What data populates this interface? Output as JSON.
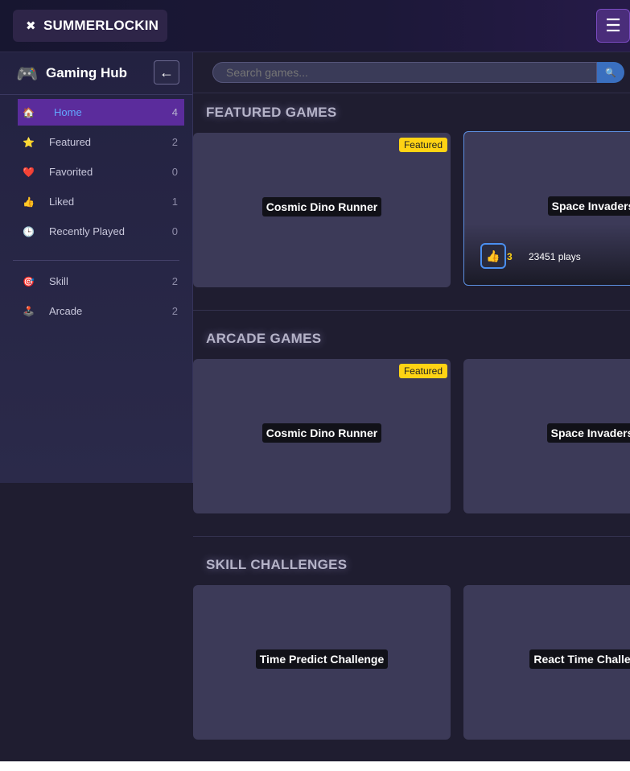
{
  "brand": {
    "icon": "✖",
    "name": "SUMMERLOCKIN"
  },
  "menu_icon": "☰",
  "sidebar": {
    "logo_icon": "🎮",
    "title": "Gaming Hub",
    "collapse_icon": "←",
    "items": [
      {
        "icon": "🏠",
        "label": "Home",
        "count": "4",
        "active": true
      },
      {
        "icon": "⭐",
        "label": "Featured",
        "count": "2"
      },
      {
        "icon": "❤️",
        "label": "Favorited",
        "count": "0"
      },
      {
        "icon": "👍",
        "label": "Liked",
        "count": "1"
      },
      {
        "icon": "🕒",
        "label": "Recently Played",
        "count": "0"
      }
    ],
    "categories": [
      {
        "icon": "🎯",
        "label": "Skill",
        "count": "2"
      },
      {
        "icon": "🕹️",
        "label": "Arcade",
        "count": "2"
      }
    ]
  },
  "search": {
    "placeholder": "Search games...",
    "button_icon": "🔍"
  },
  "sections": [
    {
      "title": "FEATURED GAMES",
      "cards": [
        {
          "title": "Cosmic Dino Runner",
          "badge": "Featured"
        },
        {
          "title": "Space Invaders",
          "like_icon": "👍",
          "likes": "3",
          "plays": "23451 plays"
        }
      ]
    },
    {
      "title": "ARCADE GAMES",
      "cards": [
        {
          "title": "Cosmic Dino Runner",
          "badge": "Featured"
        },
        {
          "title": "Space Invaders"
        }
      ]
    },
    {
      "title": "SKILL CHALLENGES",
      "cards": [
        {
          "title": "Time Predict Challenge"
        },
        {
          "title": "React Time Challenge"
        }
      ]
    }
  ],
  "colors": {
    "accent": "#5b2c9c",
    "active_text": "#63a8ff",
    "badge": "#ffd314",
    "background": "#1f1d30"
  }
}
